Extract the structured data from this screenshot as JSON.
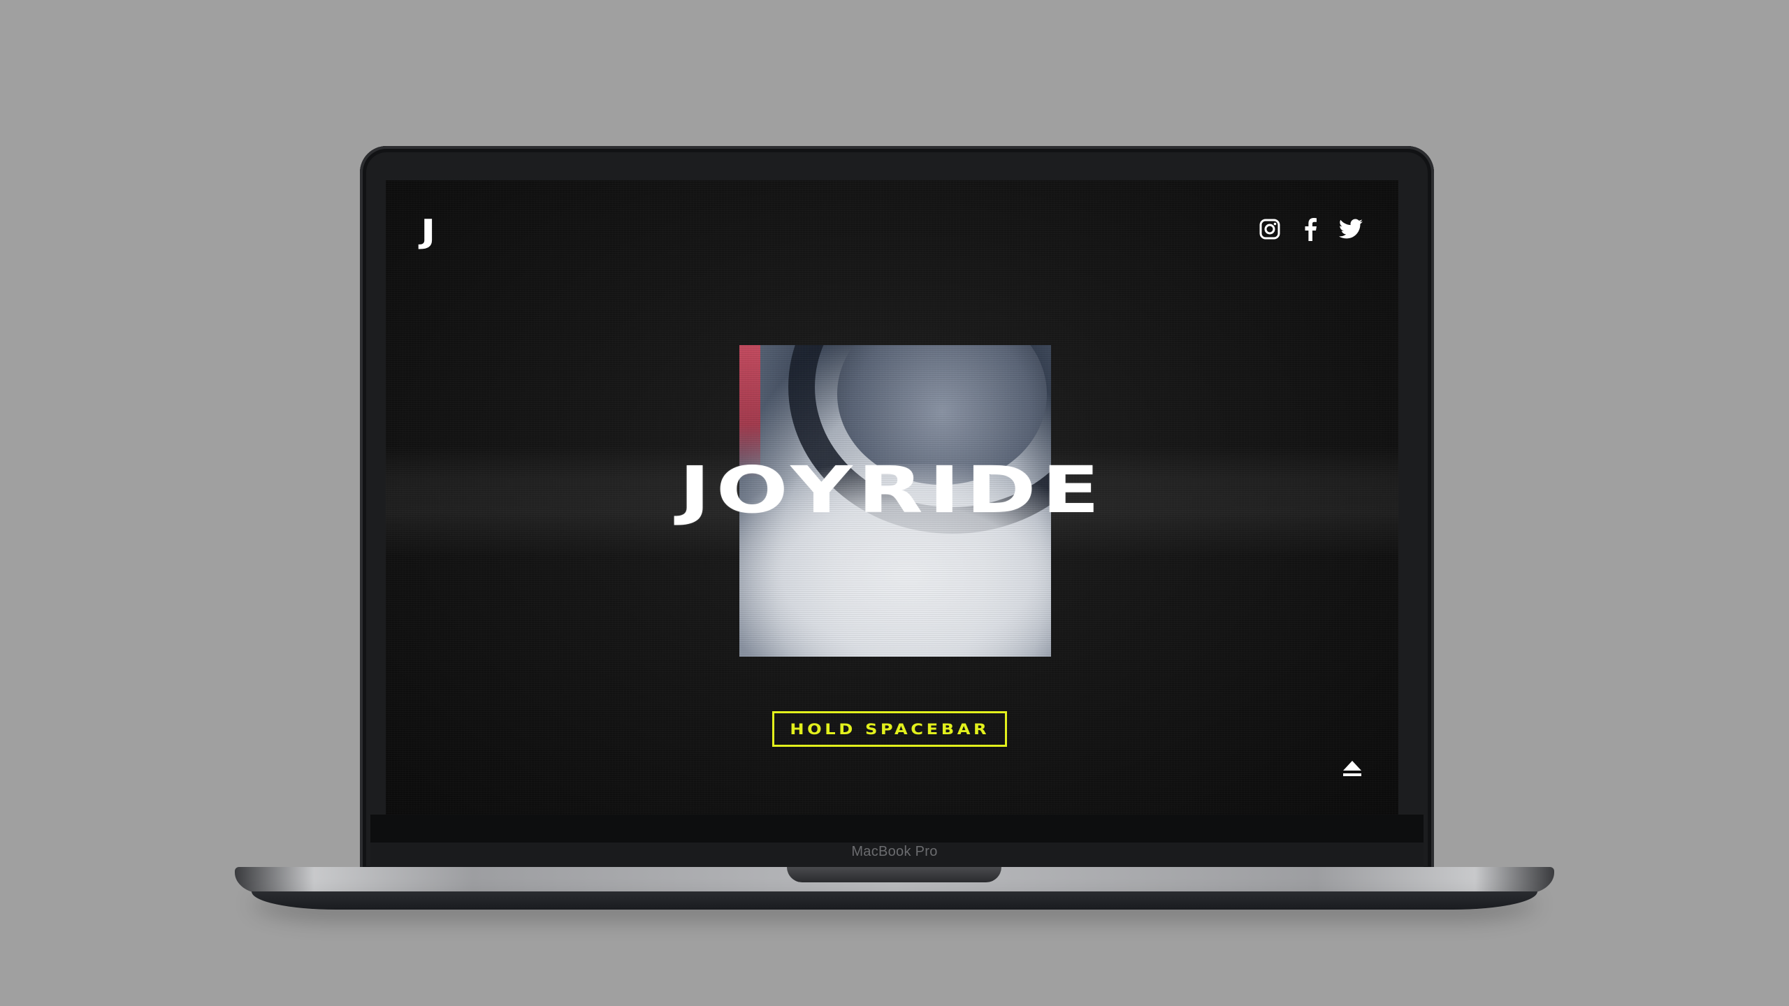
{
  "site": {
    "logo_text": "J",
    "title": "JOYRIDE",
    "cta_label": "HOLD SPACEBAR",
    "social": [
      {
        "name": "instagram",
        "icon": "instagram-icon"
      },
      {
        "name": "facebook",
        "icon": "facebook-icon"
      },
      {
        "name": "twitter",
        "icon": "twitter-icon"
      }
    ],
    "eject_icon": "eject-icon"
  },
  "device": {
    "model_label": "MacBook Pro"
  },
  "colors": {
    "accent": "#e2f01a",
    "text": "#ffffff",
    "background": "#111111",
    "stage": "#a0a0a0"
  }
}
